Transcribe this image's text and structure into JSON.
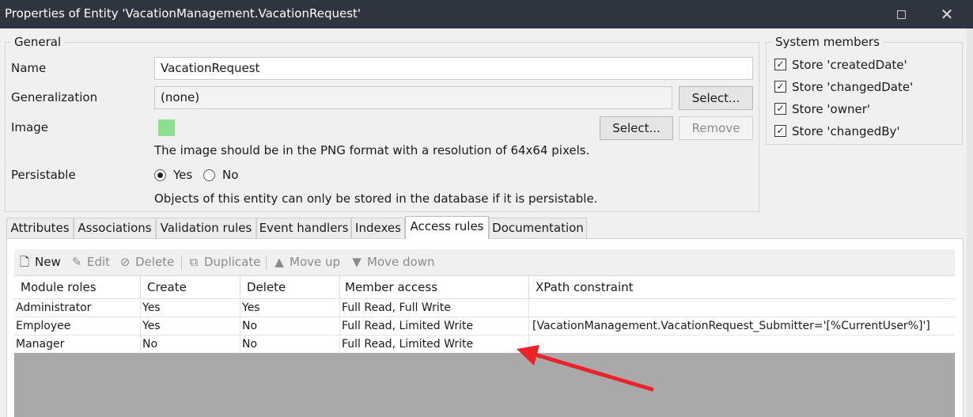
{
  "window": {
    "title": "Properties of Entity 'VacationManagement.VacationRequest'"
  },
  "general": {
    "legend": "General",
    "name_label": "Name",
    "name_value": "VacationRequest",
    "generalization_label": "Generalization",
    "generalization_value": "(none)",
    "generalization_select": "Select...",
    "image_label": "Image",
    "image_select": "Select...",
    "image_remove": "Remove",
    "image_hint": "The image should be in the PNG format with a resolution of 64x64 pixels.",
    "persistable_label": "Persistable",
    "persistable_yes": "Yes",
    "persistable_no": "No",
    "persistable_selected": "Yes",
    "persistable_hint": "Objects of this entity can only be stored in the database if it is persistable."
  },
  "system_members": {
    "legend": "System members",
    "items": [
      {
        "label": "Store 'createdDate'",
        "checked": true
      },
      {
        "label": "Store 'changedDate'",
        "checked": true
      },
      {
        "label": "Store 'owner'",
        "checked": true
      },
      {
        "label": "Store 'changedBy'",
        "checked": true
      }
    ]
  },
  "tabs": [
    {
      "label": "Attributes",
      "active": false
    },
    {
      "label": "Associations",
      "active": false
    },
    {
      "label": "Validation rules",
      "active": false
    },
    {
      "label": "Event handlers",
      "active": false
    },
    {
      "label": "Indexes",
      "active": false
    },
    {
      "label": "Access rules",
      "active": true
    },
    {
      "label": "Documentation",
      "active": false
    }
  ],
  "toolbar": {
    "new": "New",
    "edit": "Edit",
    "delete": "Delete",
    "duplicate": "Duplicate",
    "move_up": "Move up",
    "move_down": "Move down"
  },
  "access_rules": {
    "columns": [
      "Module roles",
      "Create",
      "Delete",
      "Member access",
      "XPath constraint"
    ],
    "rows": [
      [
        "Administrator",
        "Yes",
        "Yes",
        "Full Read, Full Write",
        ""
      ],
      [
        "Employee",
        "Yes",
        "No",
        "Full Read, Limited Write",
        "[VacationManagement.VacationRequest_Submitter='[%CurrentUser%]']"
      ],
      [
        "Manager",
        "No",
        "No",
        "Full Read, Limited Write",
        ""
      ]
    ]
  },
  "colors": {
    "titlebar": "#2e3440",
    "image_swatch": "#8be08b",
    "annotation_arrow": "#e8232a",
    "grid_empty": "#a9a9a9"
  }
}
